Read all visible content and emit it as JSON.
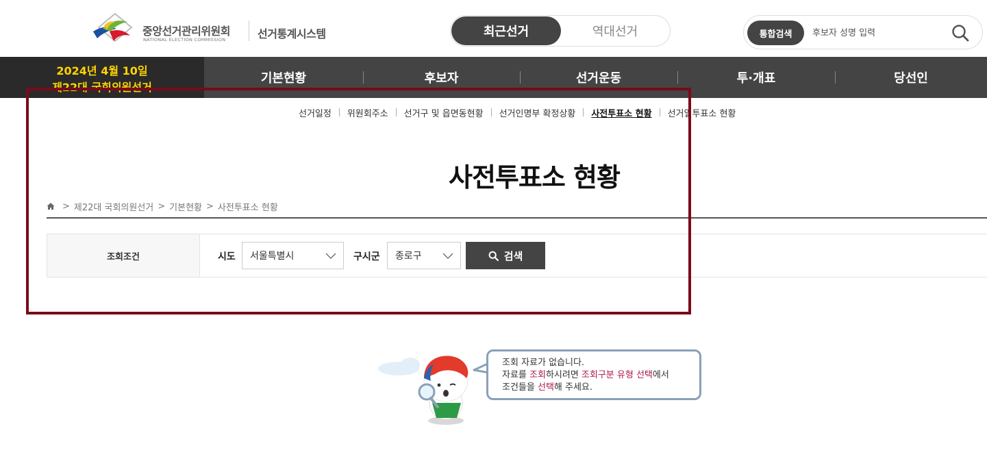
{
  "header": {
    "org_name_kr": "중앙선거관리위원회",
    "org_name_en": "NATIONAL ELECTION COMMISSION",
    "system_name": "선거통계시스템",
    "toggle": {
      "active": "최근선거",
      "inactive": "역대선거"
    },
    "search": {
      "badge": "통합검색",
      "placeholder": "후보자 성명 입력",
      "icon": "search-icon"
    }
  },
  "election": {
    "date": "2024년 4월 10일",
    "name": "제22대 국회의원선거",
    "color": "#ffd400"
  },
  "nav": {
    "items": [
      {
        "label": "기본현황"
      },
      {
        "label": "후보자"
      },
      {
        "label": "선거운동"
      },
      {
        "label": "투·개표"
      },
      {
        "label": "당선인"
      }
    ]
  },
  "subnav": {
    "items": [
      {
        "label": "선거일정"
      },
      {
        "label": "위원회주소"
      },
      {
        "label": "선거구 및 읍면동현황"
      },
      {
        "label": "선거인명부 확정상황"
      },
      {
        "label": "사전투표소 현황",
        "active": true
      },
      {
        "label": "선거일투표소 현황"
      }
    ]
  },
  "page": {
    "title": "사전투표소 현황",
    "breadcrumb": [
      "제22대 국회의원선거",
      "기본현황",
      "사전투표소 현황"
    ]
  },
  "filter": {
    "label": "조회조건",
    "sido_label": "시도",
    "sido_value": "서울특별시",
    "gusi_label": "구시군",
    "gusi_value": "종로구",
    "search_button": "검색"
  },
  "empty": {
    "line1": "조회 자료가 없습니다.",
    "line2_a": "자료를 ",
    "line2_b": "조회",
    "line2_c": "하시려면 ",
    "line2_d": "조회구분 유형 선택",
    "line2_e": "에서",
    "line3_a": "조건들을 ",
    "line3_b": "선택",
    "line3_c": "해 주세요.",
    "highlight_color": "#b0174e"
  },
  "colors": {
    "primary_dark": "#444444",
    "highlight_frame": "#7a0a1a"
  }
}
